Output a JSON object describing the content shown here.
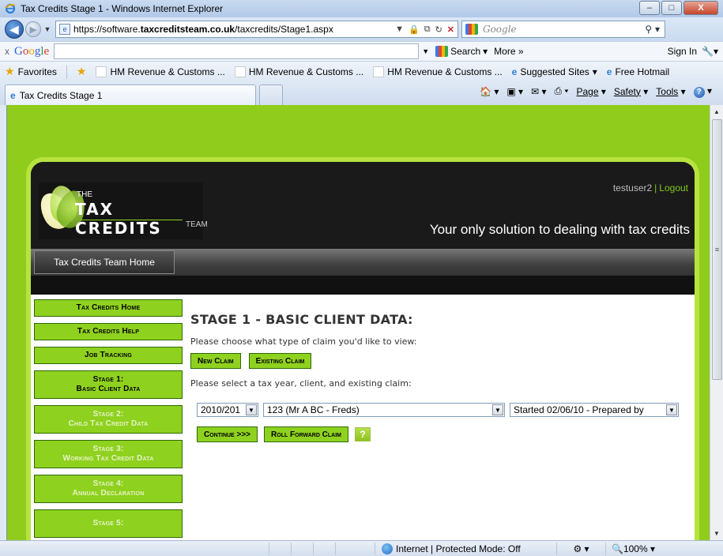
{
  "window": {
    "title": "Tax Credits Stage 1 - Windows Internet Explorer",
    "minimize": "–",
    "maximize": "□",
    "close": "X"
  },
  "address": {
    "url_prefix": "https://software.",
    "url_domain": "taxcreditsteam.co.uk",
    "url_path": "/taxcredits/Stage1.aspx",
    "search_placeholder": "Google"
  },
  "google_toolbar": {
    "close": "x",
    "search_label": "Search",
    "more_label": "More »",
    "sign_in": "Sign In"
  },
  "favorites": {
    "label": "Favorites",
    "items": [
      "HM Revenue & Customs ...",
      "HM Revenue & Customs ...",
      "HM Revenue & Customs ..."
    ],
    "suggested": "Suggested Sites",
    "hotmail": "Free Hotmail"
  },
  "tabs": {
    "active": "Tax Credits Stage 1"
  },
  "commandbar": {
    "page": "Page",
    "safety": "Safety",
    "tools": "Tools"
  },
  "site": {
    "logo_the": "THE",
    "logo_name": "TAX CREDITS",
    "logo_team": "TEAM",
    "username": "testuser2",
    "logout": "Logout",
    "slogan": "Your only solution to dealing with tax credits",
    "home_button": "Tax Credits Team Home"
  },
  "sidebar": {
    "items": [
      {
        "line1": "Tax Credits Home",
        "line2": ""
      },
      {
        "line1": "Tax Credits Help",
        "line2": ""
      },
      {
        "line1": "Job Tracking",
        "line2": ""
      },
      {
        "line1": "Stage 1:",
        "line2": "Basic Client Data"
      },
      {
        "line1": "Stage 2:",
        "line2": "Child Tax Credit Data"
      },
      {
        "line1": "Stage 3:",
        "line2": "Working Tax Credit Data"
      },
      {
        "line1": "Stage 4:",
        "line2": "Annual Declaration"
      },
      {
        "line1": "Stage 5:",
        "line2": ""
      }
    ]
  },
  "main": {
    "title": "STAGE 1 - BASIC CLIENT DATA:",
    "prompt1": "Please choose what type of claim you'd like to view:",
    "new_claim": "New Claim",
    "existing_claim": "Existing Claim",
    "prompt2": "Please select a tax year, client, and existing claim:",
    "tax_year": "2010/201",
    "client": "123 (Mr A BC - Freds)",
    "claim": "Started 02/06/10 - Prepared by",
    "continue": "Continue >>>",
    "roll_forward": "Roll Forward Claim",
    "help": "?"
  },
  "status": {
    "zone": "Internet | Protected Mode: Off",
    "zoom": "100%"
  },
  "colors": {
    "accent_green": "#8fd11f",
    "site_dark": "#1a1a1a",
    "page_bg_green": "#8fcc1c"
  }
}
